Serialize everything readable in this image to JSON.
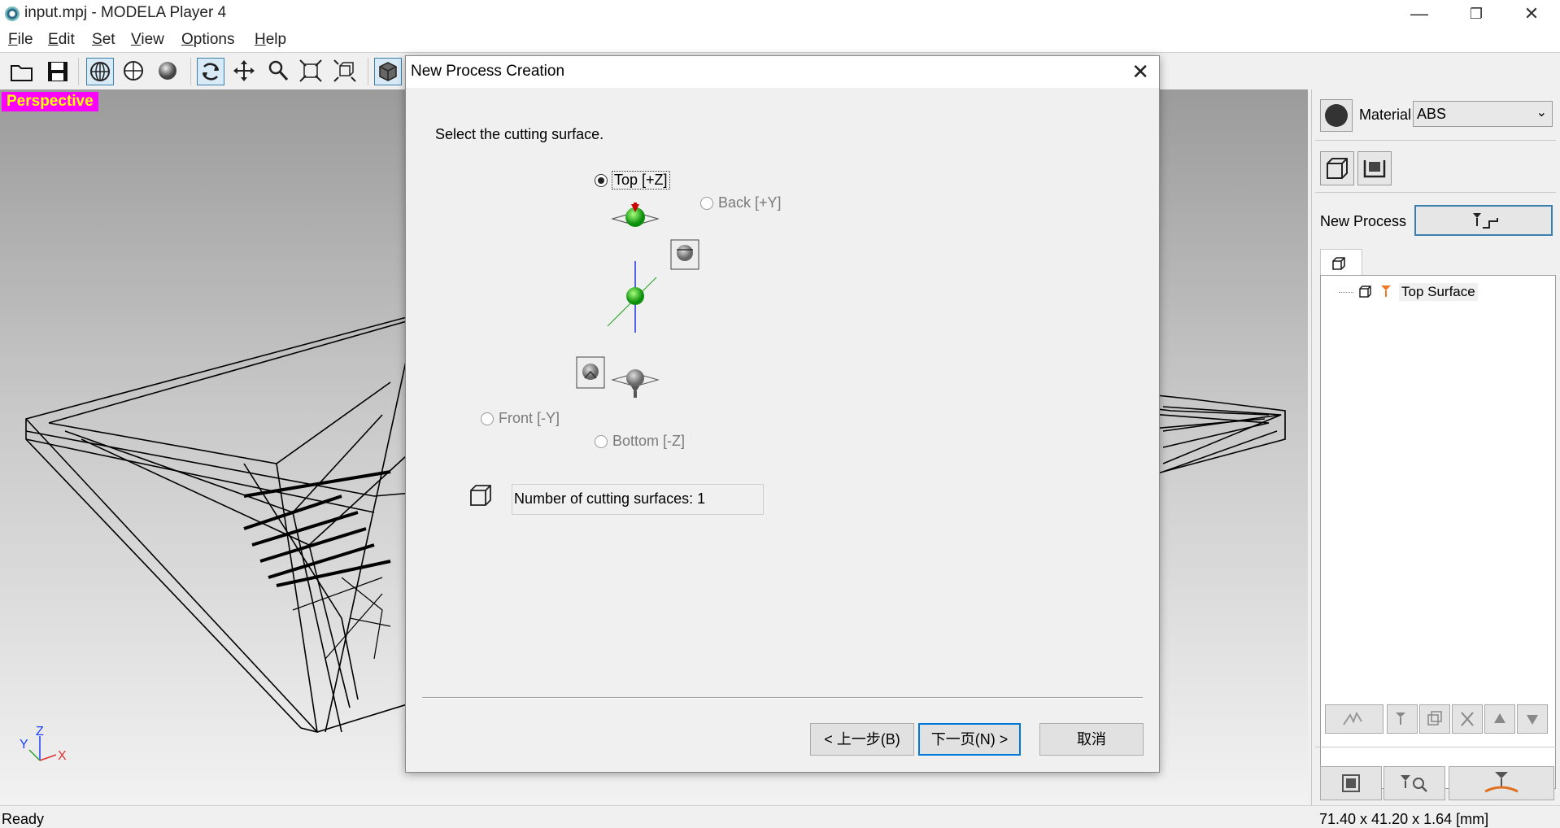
{
  "window": {
    "title": "input.mpj - MODELA Player 4",
    "minimize": "—",
    "restore": "❐",
    "close": "✕"
  },
  "menu": {
    "file": {
      "u": "F",
      "rest": "ile"
    },
    "edit": {
      "u": "E",
      "rest": "dit"
    },
    "set": {
      "u": "S",
      "rest": "et"
    },
    "view": {
      "u": "V",
      "rest": "iew"
    },
    "options": {
      "u": "O",
      "rest": "ptions"
    },
    "help": {
      "u": "H",
      "rest": "elp"
    }
  },
  "viewport": {
    "label": "Perspective",
    "axis_y": "Y",
    "axis_z": "Z",
    "axis_x": "X"
  },
  "dialog": {
    "title": "New Process Creation",
    "close": "✕",
    "prompt": "Select the cutting surface.",
    "options": {
      "top": "Top [+Z]",
      "back": "Back [+Y]",
      "front": "Front [-Y]",
      "bottom": "Bottom [-Z]"
    },
    "selected": "top",
    "count_field": "Number of cutting surfaces: 1",
    "buttons": {
      "back": "< 上一步(B)",
      "next": "下一页(N) >",
      "cancel": "取消"
    }
  },
  "right_panel": {
    "material_label": "Material",
    "material_value": "ABS",
    "new_process_label": "New Process",
    "tree_item": "Top Surface"
  },
  "status": {
    "left": "Ready",
    "right": "71.40 x 41.20 x 1.64 [mm]"
  },
  "colors": {
    "perspective_bg": "#ff00ff",
    "perspective_fg": "#ffff00",
    "accent": "#0078d7"
  }
}
